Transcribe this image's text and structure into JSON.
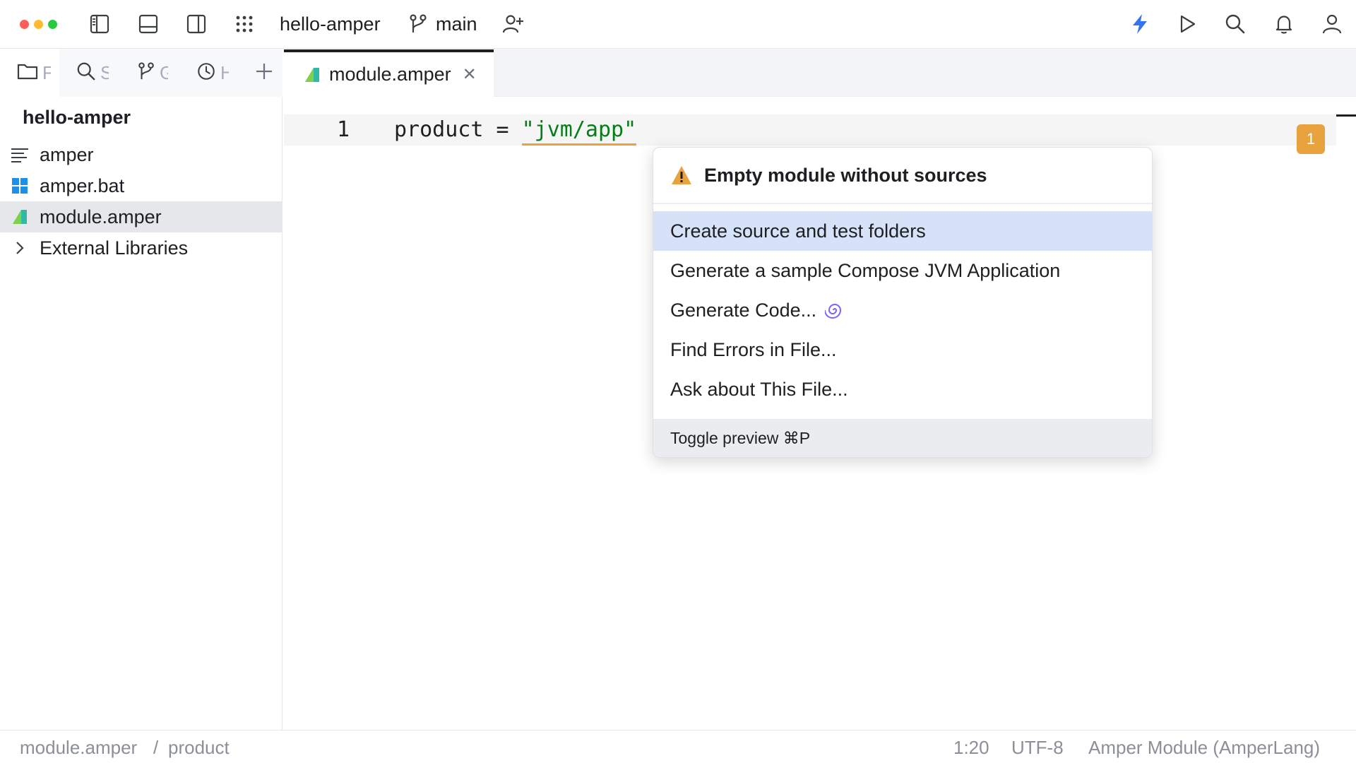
{
  "titlebar": {
    "project_name": "hello-amper",
    "branch": "main",
    "traffic_colors": [
      "#ff5f57",
      "#febc2e",
      "#28c840"
    ],
    "left_icons": [
      "sidebar-left-icon",
      "panel-bottom-icon",
      "sidebar-right-icon",
      "grid-menu-icon"
    ],
    "right_icons": [
      "bolt-icon",
      "run-icon",
      "search-icon",
      "bell-icon",
      "user-icon"
    ],
    "accent_color": "#3574f0"
  },
  "left_tabs": [
    {
      "icon": "folder-icon",
      "label": "F"
    },
    {
      "icon": "search-icon",
      "label": "S"
    },
    {
      "icon": "git-branch-icon",
      "label": "G"
    },
    {
      "icon": "clock-icon",
      "label": "H"
    }
  ],
  "sidebar": {
    "title": "hello-amper",
    "items": [
      {
        "icon": "text-lines-icon",
        "label": "amper"
      },
      {
        "icon": "windows-icon",
        "label": "amper.bat"
      },
      {
        "icon": "amper-logo-icon",
        "label": "module.amper"
      },
      {
        "icon": "chevron-right-icon",
        "label": "External Libraries"
      }
    ]
  },
  "editor": {
    "tab_label": "module.amper",
    "line_number": "1",
    "code_key": "product",
    "code_op": " = ",
    "code_value": "\"jvm/app\"",
    "warning_count": "1"
  },
  "popup": {
    "title": "Empty module without sources",
    "items": [
      "Create source and test folders",
      "Generate a sample Compose JVM Application",
      "Generate Code...",
      "Find Errors in File...",
      "Ask about This File..."
    ],
    "footer": "Toggle preview ⌘P"
  },
  "statusbar": {
    "breadcrumb_file": "module.amper",
    "breadcrumb_sep": "/",
    "breadcrumb_node": "product",
    "position": "1:20",
    "encoding": "UTF-8",
    "file_type": "Amper Module (AmperLang)"
  }
}
